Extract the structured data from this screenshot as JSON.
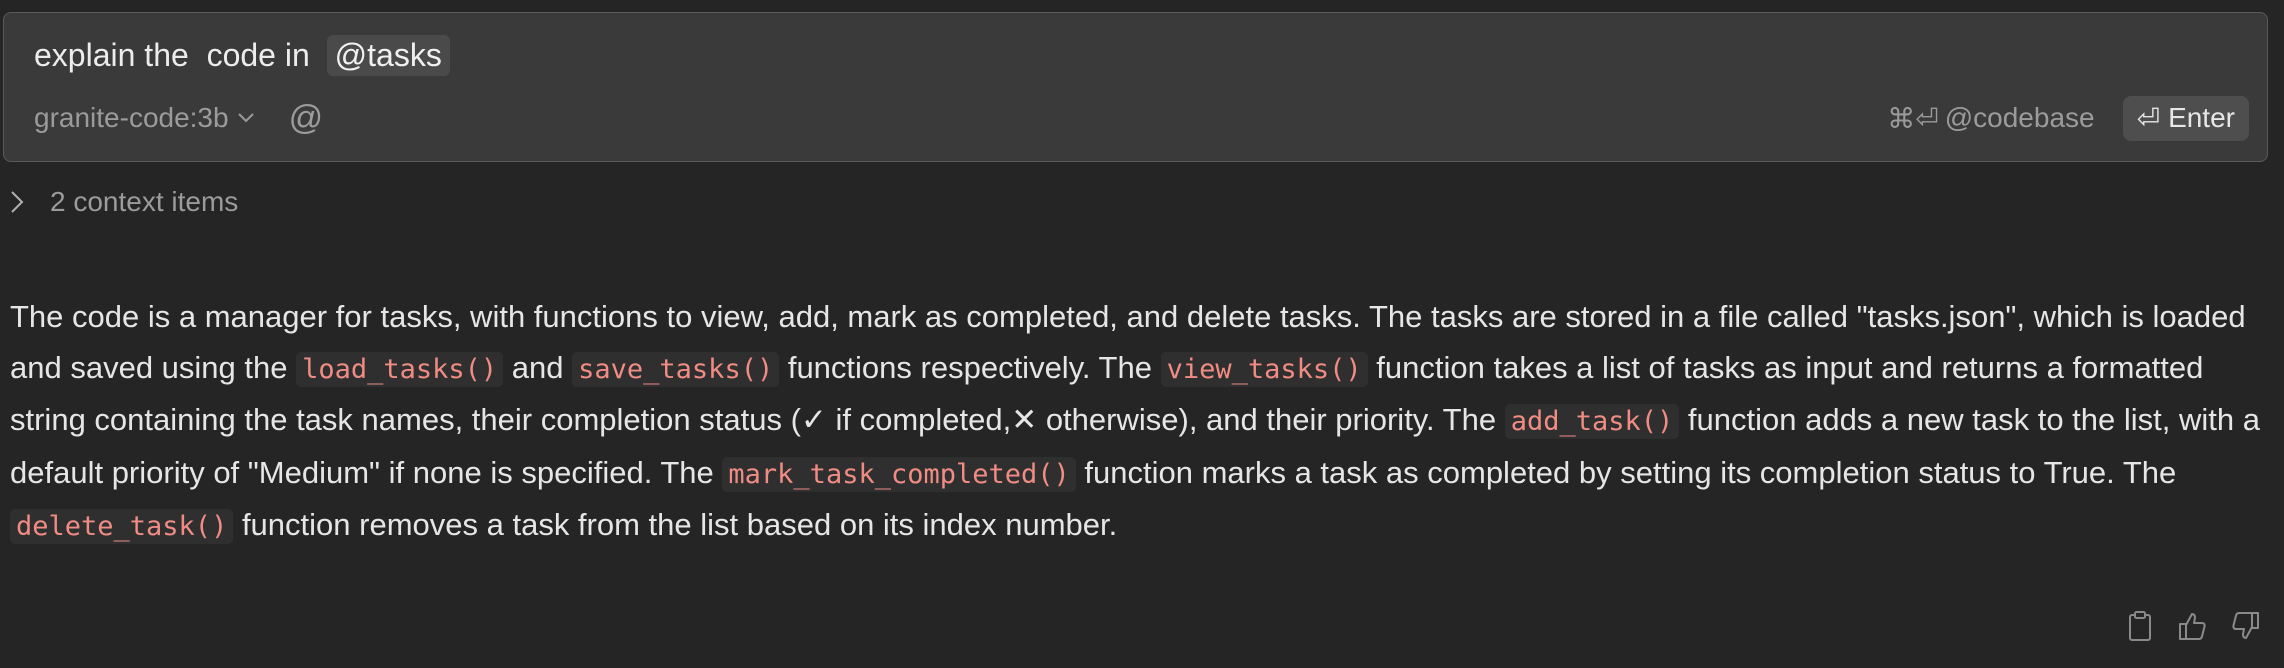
{
  "input": {
    "prompt_text": "explain the  code in ",
    "mention": "@tasks",
    "model": "granite-code:3b",
    "at_symbol": "@",
    "codebase_shortcut": "⌘⏎",
    "codebase_label": "@codebase",
    "enter_glyph": "⏎",
    "enter_label": "Enter"
  },
  "context": {
    "label": "2 context items"
  },
  "response": {
    "s1": "The code is a manager for tasks, with functions to view, add, mark as completed, and delete tasks. The tasks are stored in a file called \"tasks.json\", which is loaded and saved using the ",
    "c1": "load_tasks()",
    "s2": " and ",
    "c2": "save_tasks()",
    "s3": " functions respectively. The ",
    "c3": "view_tasks()",
    "s4": " function takes a list of tasks as input and returns a formatted string containing the task names, their completion status (✓ if completed,✕ otherwise), and their priority. The ",
    "c4": "add_task()",
    "s5": " function adds a new task to the list, with a default priority of \"Medium\" if none is specified. The ",
    "c5": "mark_task_completed()",
    "s6": " function marks a task as completed by setting its completion status to True. The ",
    "c6": "delete_task()",
    "s7": " function removes a task from the list based on its index number."
  },
  "icons": {
    "model_dropdown": "chevron-down-icon",
    "context_toggle": "chevron-right-icon",
    "copy": "clipboard-icon",
    "like": "thumbs-up-icon",
    "dislike": "thumbs-down-icon"
  },
  "colors": {
    "background": "#252525",
    "input_background": "#3a3a3a",
    "inline_code": "#f08c84",
    "muted_text": "#9b9b9b"
  }
}
